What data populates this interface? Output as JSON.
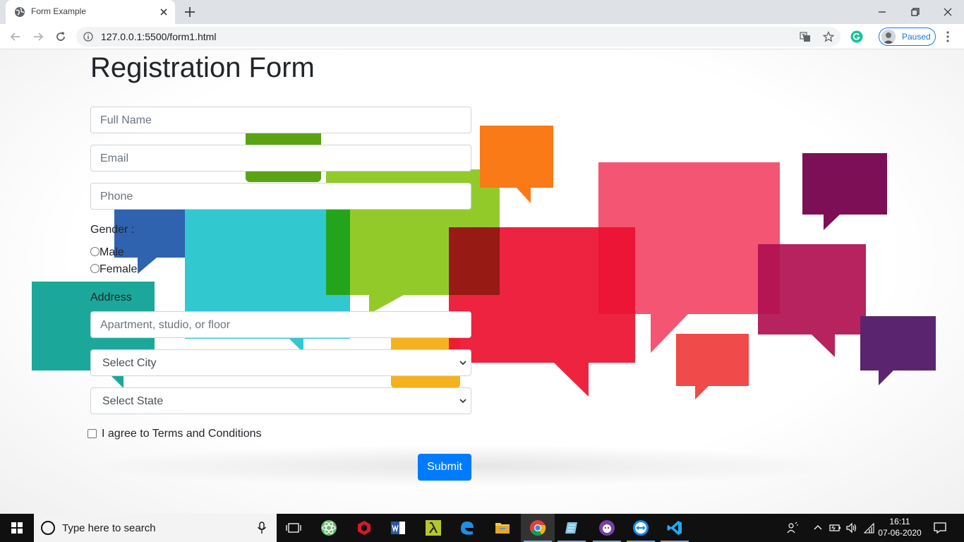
{
  "browser": {
    "tab_title": "Form Example",
    "url": "127.0.0.1:5500/form1.html",
    "profile_status": "Paused"
  },
  "form": {
    "title": "Registration Form",
    "full_name_placeholder": "Full Name",
    "email_placeholder": "Email",
    "phone_placeholder": "Phone",
    "gender_label": "Gender :",
    "gender_options": [
      "Male",
      "Female"
    ],
    "address_label": "Address",
    "address_placeholder": "Apartment, studio, or floor",
    "city_selected": "Select City",
    "state_selected": "Select State",
    "terms_label": "I agree to Terms and Conditions",
    "submit_label": "Submit"
  },
  "taskbar": {
    "search_placeholder": "Type here to search",
    "time": "16:11",
    "date": "07-06-2020",
    "apps": [
      "task-view",
      "atom",
      "app-red",
      "word",
      "lambda",
      "edge",
      "file-explorer",
      "chrome",
      "notepad",
      "app-purple",
      "teamviewer",
      "vscode"
    ]
  },
  "colors": {
    "primary": "#007bff",
    "accent_blue": "#1a73e8"
  }
}
